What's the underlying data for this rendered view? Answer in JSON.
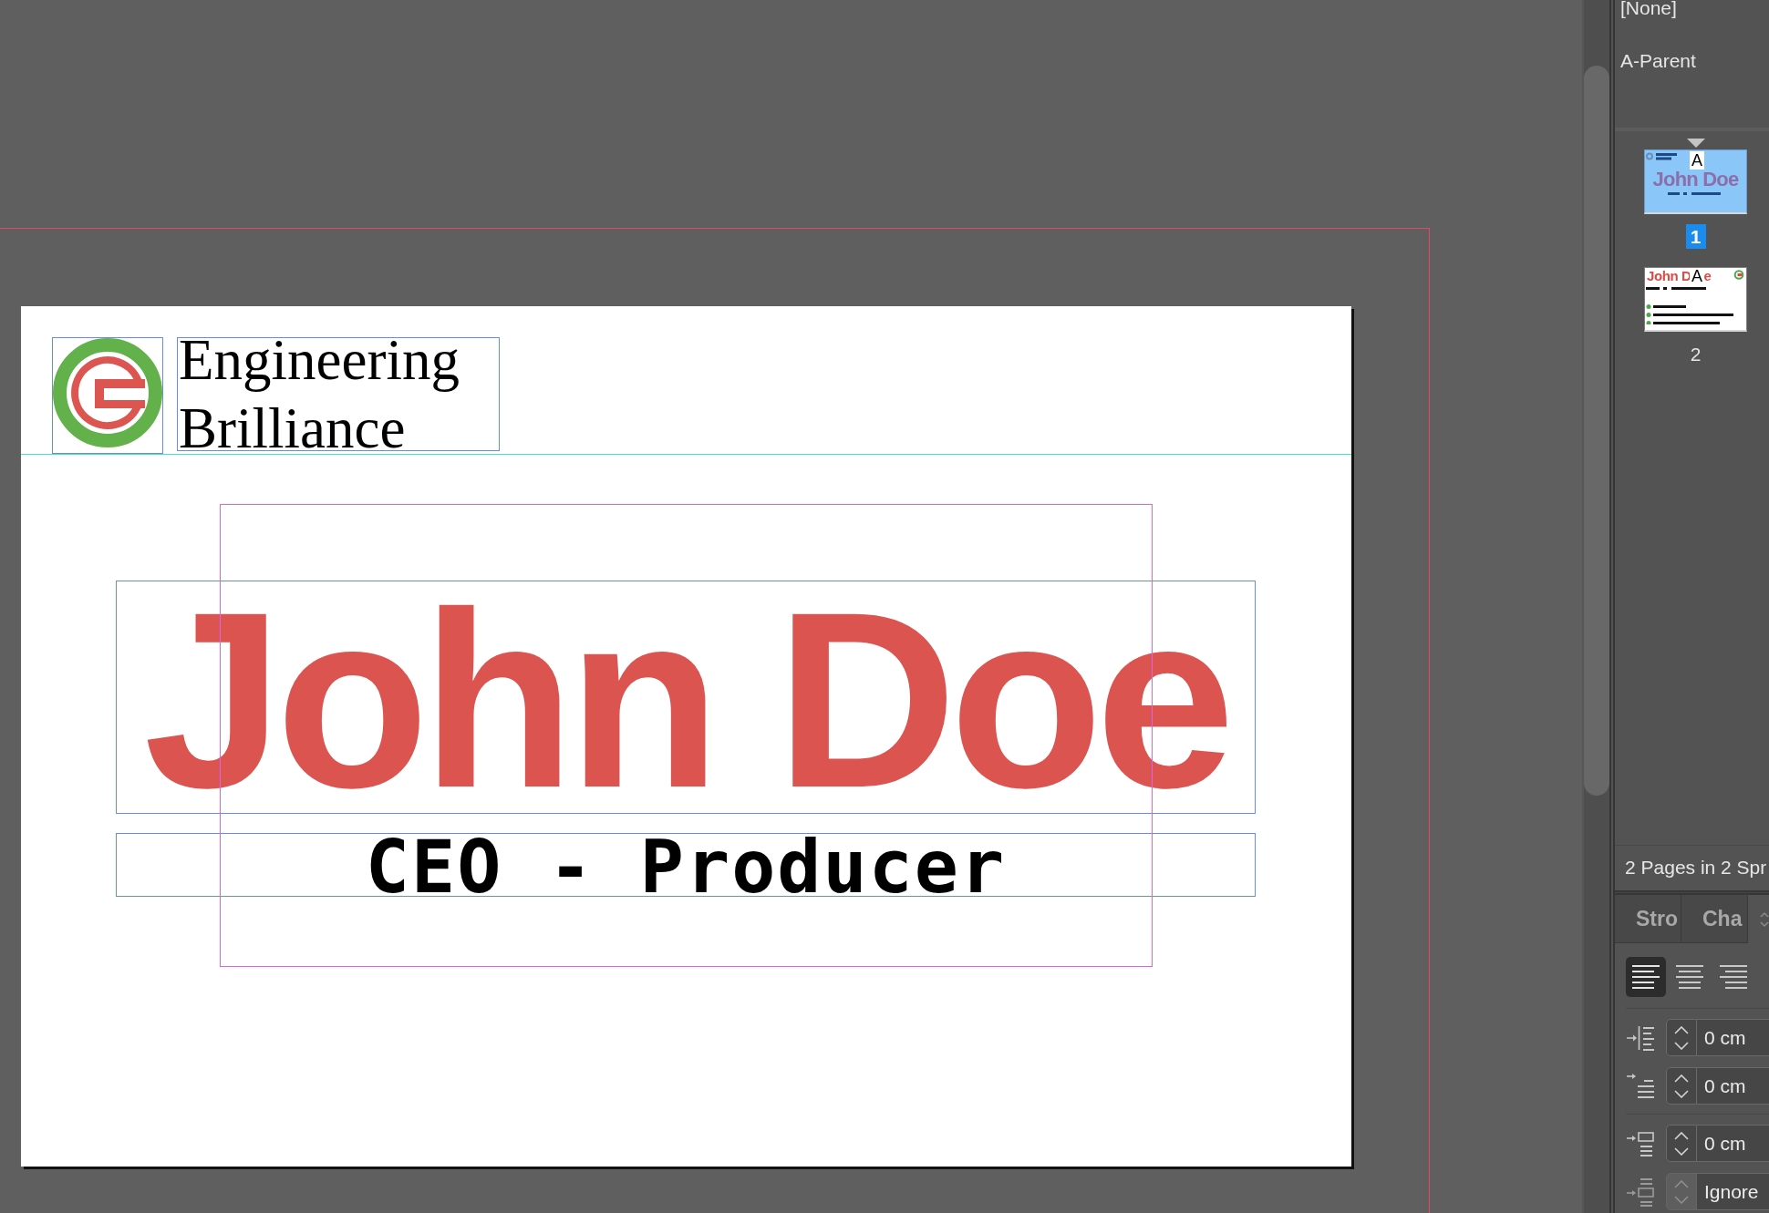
{
  "canvas": {
    "page": {
      "company_name": "Engineering Brilliance",
      "name": "John Doe",
      "title": "CEO - Producer"
    }
  },
  "pages_panel": {
    "parents": [
      {
        "label": "[None]"
      },
      {
        "label": "A-Parent"
      }
    ],
    "pages": [
      {
        "kind": "centered",
        "parent": "A",
        "name": [
          "John Doe"
        ],
        "number": "1",
        "selected": true
      },
      {
        "kind": "contact",
        "parent": "A",
        "name": [
          "John D",
          "e"
        ],
        "number": "2",
        "selected": false
      }
    ],
    "summary": "2 Pages in 2 Spr"
  },
  "paragraph_panel": {
    "tabs": [
      {
        "label": "Stro",
        "selected": false
      },
      {
        "label": "Cha",
        "selected": false
      }
    ],
    "alignment": [
      {
        "kind": "left",
        "selected": true
      },
      {
        "kind": "center",
        "selected": false
      },
      {
        "kind": "right",
        "selected": false
      }
    ],
    "indent_fields": [
      {
        "kind": "left-indent",
        "value": "0 cm",
        "disabled": false
      },
      {
        "kind": "first-line-indent",
        "value": "0 cm",
        "disabled": false
      }
    ],
    "spacing_fields": [
      {
        "kind": "space-before",
        "value": "0 cm",
        "disabled": false
      },
      {
        "kind": "same-style-spacing",
        "value": "Ignore",
        "disabled": true
      }
    ]
  }
}
